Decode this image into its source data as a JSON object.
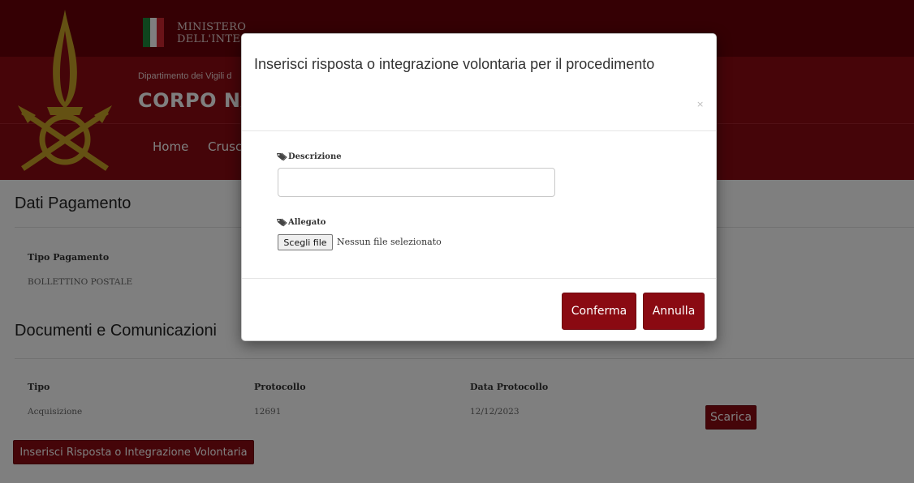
{
  "colors": {
    "brand_dark": "#6b0009",
    "brand": "#8e0a12",
    "button": "#8a0a12"
  },
  "header": {
    "ministero_line1": "MINISTERO",
    "ministero_line2": "DELL'INTE",
    "dipartimento": "Dipartimento dei Vigili d",
    "corpo": "CORPO NAZ",
    "nav": {
      "home": "Home",
      "cruscotto": "Crusco"
    },
    "emblem_icon": "flame-emblem-icon"
  },
  "pagamento": {
    "title": "Dati Pagamento",
    "tipo_label": "Tipo Pagamento",
    "tipo_value": "BOLLETTINO POSTALE"
  },
  "documenti": {
    "title": "Documenti e Comunicazioni",
    "columns": [
      "Tipo",
      "Protocollo",
      "Data Protocollo"
    ],
    "rows": [
      {
        "tipo": "Acquisizione",
        "protocollo": "12691",
        "data": "12/12/2023",
        "action": "Scarica"
      }
    ],
    "insert_button": "Inserisci Risposta o Integrazione Volontaria"
  },
  "modal": {
    "title": "Inserisci risposta o integrazione volontaria per il procedimento",
    "close": "×",
    "descrizione_label": "Descrizione",
    "descrizione_value": "",
    "allegato_label": "Allegato",
    "file_button": "Scegli file",
    "file_status": "Nessun file selezionato",
    "confirm": "Conferma",
    "cancel": "Annulla"
  }
}
